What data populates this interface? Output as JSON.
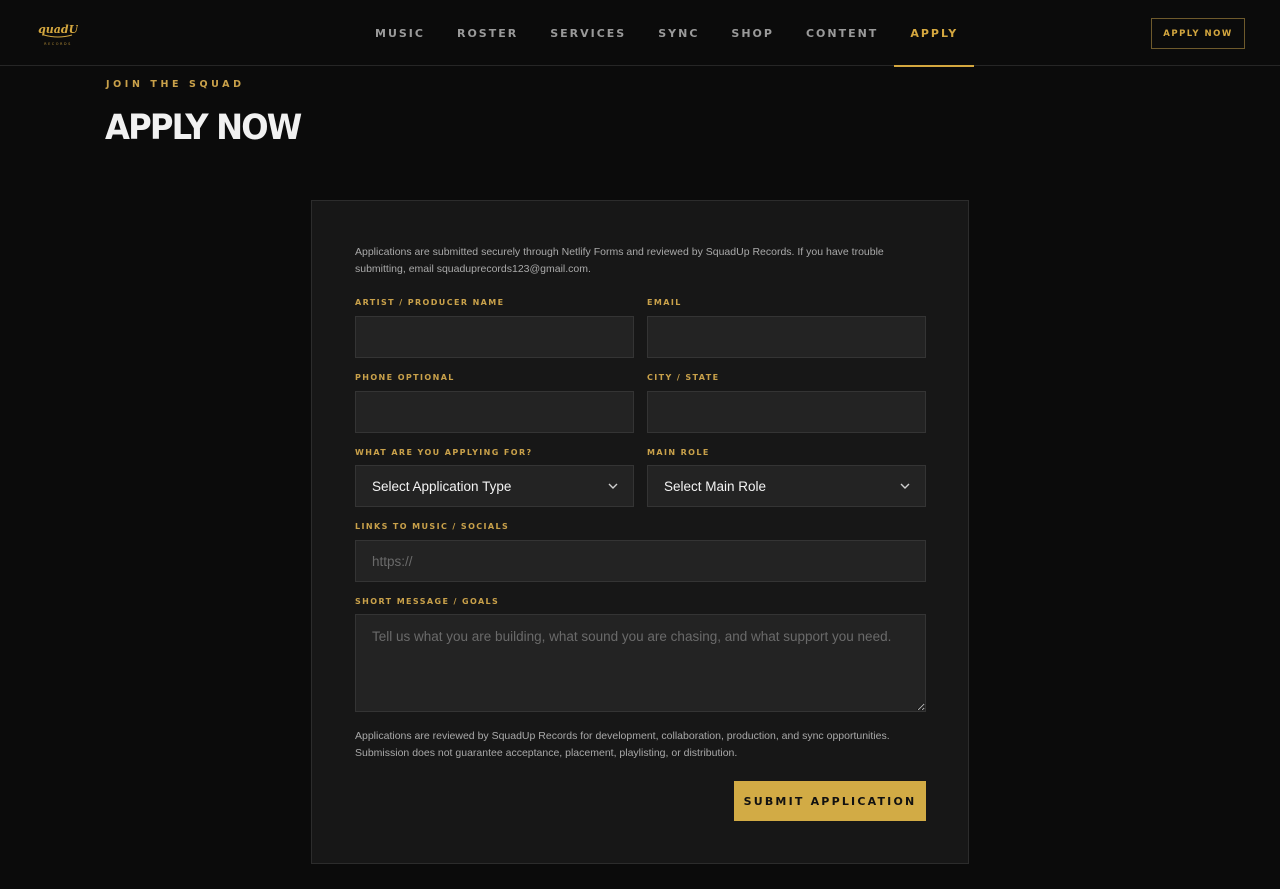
{
  "brand": {
    "logo_text": "SquadUp",
    "logo_subtext": "RECORDS",
    "accent": "#d4a73f"
  },
  "nav": {
    "items": [
      {
        "label": "MUSIC"
      },
      {
        "label": "ROSTER"
      },
      {
        "label": "SERVICES"
      },
      {
        "label": "SYNC"
      },
      {
        "label": "SHOP"
      },
      {
        "label": "CONTENT"
      },
      {
        "label": "APPLY"
      }
    ],
    "active": "APPLY",
    "cta_label": "APPLY NOW"
  },
  "header": {
    "eyebrow": "JOIN THE SQUAD",
    "title": "APPLY NOW"
  },
  "form": {
    "intro": "Applications are submitted securely through Netlify Forms and reviewed by SquadUp Records. If you have trouble submitting, email squaduprecords123@gmail.com.",
    "fields": {
      "name": {
        "label": "ARTIST / PRODUCER NAME",
        "value": "",
        "placeholder": ""
      },
      "email": {
        "label": "EMAIL",
        "value": "",
        "placeholder": ""
      },
      "phone": {
        "label": "PHONE OPTIONAL",
        "value": "",
        "placeholder": ""
      },
      "city": {
        "label": "CITY / STATE",
        "value": "",
        "placeholder": ""
      },
      "application_type": {
        "label": "WHAT ARE YOU APPLYING FOR?",
        "selected": "Select Application Type"
      },
      "main_role": {
        "label": "MAIN ROLE",
        "selected": "Select Main Role"
      },
      "links": {
        "label": "LINKS TO MUSIC / SOCIALS",
        "value": "",
        "placeholder": "https://"
      },
      "message": {
        "label": "SHORT MESSAGE / GOALS",
        "value": "",
        "placeholder": "Tell us what you are building, what sound you are chasing, and what support you need."
      }
    },
    "disclaimer": "Applications are reviewed by SquadUp Records for development, collaboration, production, and sync opportunities. Submission does not guarantee acceptance, placement, playlisting, or distribution.",
    "submit_label": "SUBMIT APPLICATION"
  }
}
